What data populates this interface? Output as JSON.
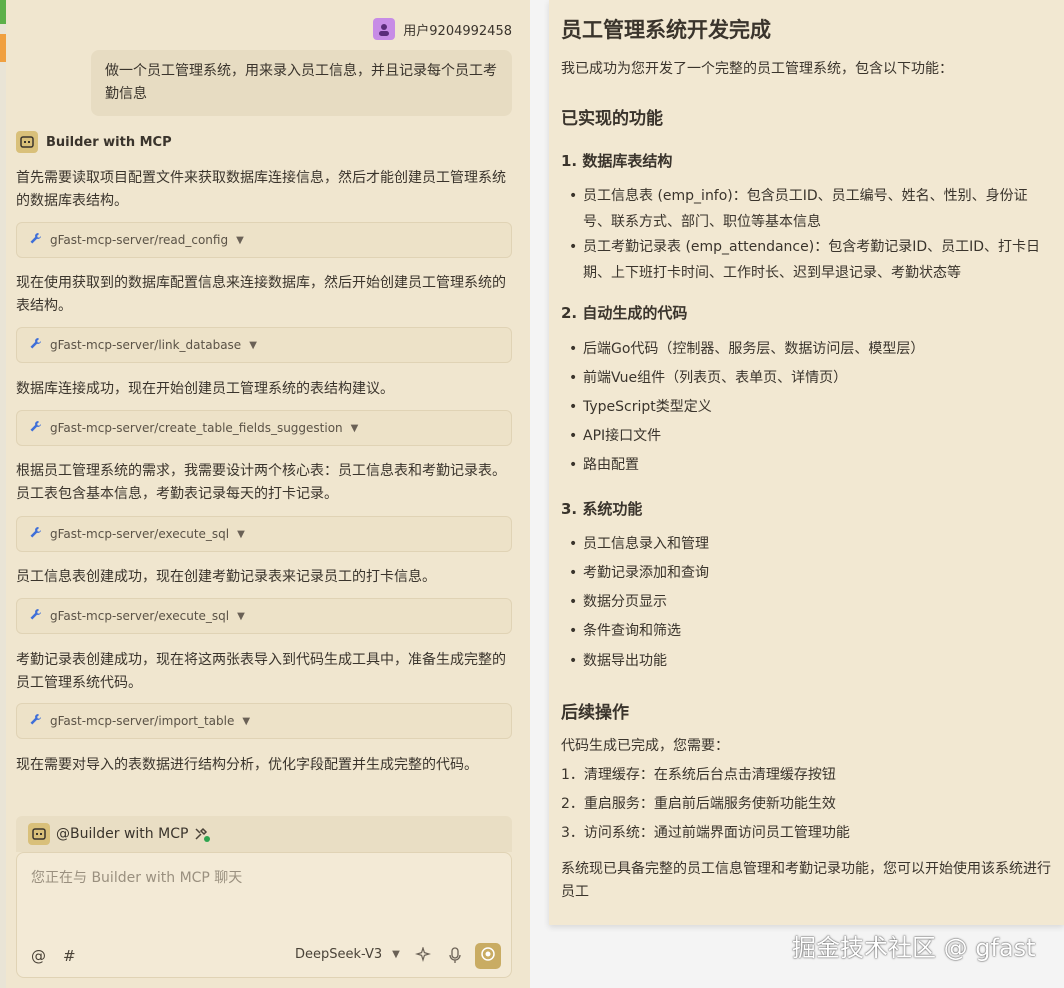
{
  "user": {
    "name": "用户9204992458"
  },
  "user_message": "做一个员工管理系统，用来录入员工信息，并且记录每个员工考勤信息",
  "bot": {
    "name": "Builder with MCP"
  },
  "chat_steps": [
    {
      "text": "首先需要读取项目配置文件来获取数据库连接信息，然后才能创建员工管理系统的数据库表结构。",
      "tool": "gFast-mcp-server/read_config"
    },
    {
      "text": "现在使用获取到的数据库配置信息来连接数据库，然后开始创建员工管理系统的表结构。",
      "tool": "gFast-mcp-server/link_database"
    },
    {
      "text": "数据库连接成功，现在开始创建员工管理系统的表结构建议。",
      "tool": "gFast-mcp-server/create_table_fields_suggestion"
    },
    {
      "text": "根据员工管理系统的需求，我需要设计两个核心表：员工信息表和考勤记录表。员工表包含基本信息，考勤表记录每天的打卡记录。",
      "tool": "gFast-mcp-server/execute_sql"
    },
    {
      "text": "员工信息表创建成功，现在创建考勤记录表来记录员工的打卡信息。",
      "tool": "gFast-mcp-server/execute_sql"
    },
    {
      "text": "考勤记录表创建成功，现在将这两张表导入到代码生成工具中，准备生成完整的员工管理系统代码。",
      "tool": "gFast-mcp-server/import_table"
    },
    {
      "text": "现在需要对导入的表数据进行结构分析，优化字段配置并生成完整的代码。"
    }
  ],
  "composer": {
    "mention": "@Builder with MCP",
    "placeholder": "您正在与 Builder with MCP 聊天",
    "model": "DeepSeek-V3",
    "at_symbol": "@",
    "hash_symbol": "#"
  },
  "result": {
    "title": "员工管理系统开发完成",
    "intro": "我已成功为您开发了一个完整的员工管理系统，包含以下功能：",
    "features_heading": "已实现的功能",
    "sec1_heading": "1. 数据库表结构",
    "sec1_items": [
      "员工信息表 (emp_info)：包含员工ID、员工编号、姓名、性别、身份证号、联系方式、部门、职位等基本信息",
      "员工考勤记录表 (emp_attendance)：包含考勤记录ID、员工ID、打卡日期、上下班打卡时间、工作时长、迟到早退记录、考勤状态等"
    ],
    "sec2_heading": "2. 自动生成的代码",
    "sec2_items": [
      "后端Go代码（控制器、服务层、数据访问层、模型层）",
      "前端Vue组件（列表页、表单页、详情页）",
      "TypeScript类型定义",
      "API接口文件",
      "路由配置"
    ],
    "sec3_heading": "3. 系统功能",
    "sec3_items": [
      "员工信息录入和管理",
      "考勤记录添加和查询",
      "数据分页显示",
      "条件查询和筛选",
      "数据导出功能"
    ],
    "followup_heading": "后续操作",
    "followup_intro": "代码生成已完成，您需要：",
    "followup_items": [
      "1．清理缓存：在系统后台点击清理缓存按钮",
      "2．重启服务：重启前后端服务使新功能生效",
      "3．访问系统：通过前端界面访问员工管理功能"
    ],
    "closing": "系统现已具备完整的员工信息管理和考勤记录功能，您可以开始使用该系统进行员工"
  },
  "watermark": "掘金技术社区 @ gfast",
  "colors": {
    "accent": "#c9ac63",
    "panel_bg": "#f0e6cf",
    "user_avatar": "#c78ce6",
    "status_green": "#2ea44f"
  }
}
